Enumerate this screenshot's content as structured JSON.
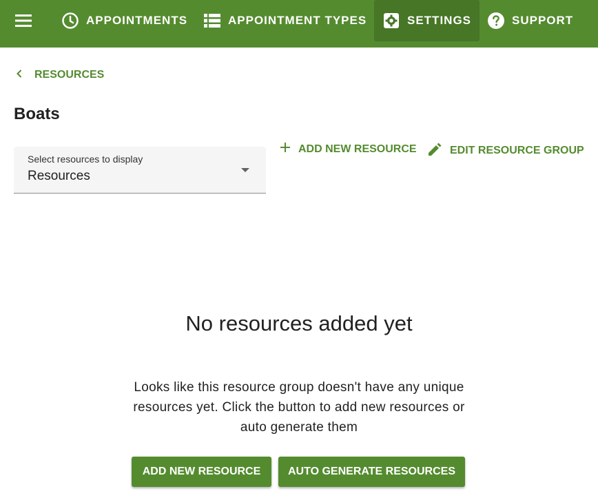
{
  "colors": {
    "brand": "#548b2f",
    "brand_dark": "#467626"
  },
  "header": {
    "menu_icon": "hamburger-menu-icon",
    "nav": [
      {
        "label": "APPOINTMENTS",
        "icon": "clock-icon",
        "active": false
      },
      {
        "label": "APPOINTMENT TYPES",
        "icon": "list-icon",
        "active": false
      },
      {
        "label": "SETTINGS",
        "icon": "gear-icon",
        "active": true
      },
      {
        "label": "SUPPORT",
        "icon": "help-icon",
        "active": false
      }
    ]
  },
  "breadcrumb": {
    "back_label": "RESOURCES",
    "icon": "chevron-left-icon"
  },
  "page": {
    "title": "Boats"
  },
  "resource_select": {
    "label": "Select resources to display",
    "value": "Resources"
  },
  "actions": {
    "add_new_resource": "ADD NEW RESOURCE",
    "edit_resource_group": "EDIT RESOURCE GROUP"
  },
  "empty_state": {
    "title": "No resources added yet",
    "description": "Looks like this resource group doesn't have any unique resources yet. Click the button to add new resources or auto generate them",
    "add_button": "ADD NEW RESOURCE",
    "auto_button": "AUTO GENERATE RESOURCES"
  }
}
